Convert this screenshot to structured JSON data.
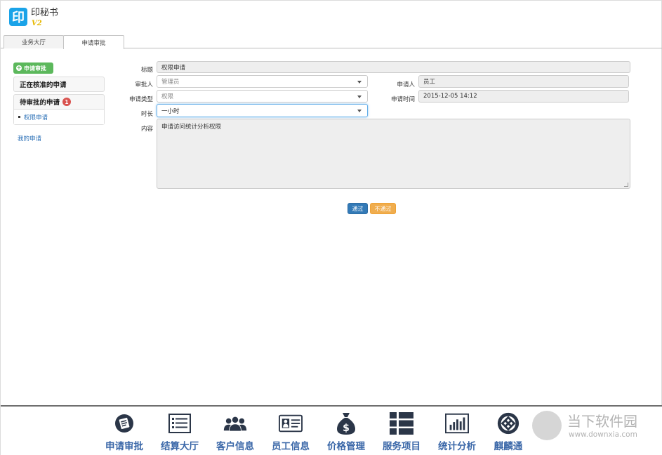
{
  "app": {
    "logo_char": "印",
    "logo_text": "印秘书",
    "version": "V2"
  },
  "tabs": [
    {
      "label": "业务大厅"
    },
    {
      "label": "申请审批"
    }
  ],
  "sidebar": {
    "apply_button": "申请审批",
    "approving_header": "正在核准的申请",
    "pending_header": "待审批的申请",
    "pending_count": "1",
    "pending_items": [
      {
        "label": "权限申请"
      }
    ],
    "my_apply": "我的申请"
  },
  "form": {
    "title_label": "标题",
    "title_value": "权限申请",
    "approver_label": "审批人",
    "approver_value": "管理员",
    "applicant_label": "申请人",
    "applicant_value": "员工",
    "type_label": "申请类型",
    "type_value": "权限",
    "time_label": "申请时间",
    "time_value": "2015-12-05 14:12",
    "duration_label": "时长",
    "duration_value": "一小时",
    "content_label": "内容",
    "content_value": "申请访问统计分析权限",
    "pass_button": "通过",
    "reject_button": "不通过"
  },
  "bottom_nav": [
    {
      "label": "申请审批",
      "icon": "approval-icon"
    },
    {
      "label": "结算大厅",
      "icon": "list-icon"
    },
    {
      "label": "客户信息",
      "icon": "users-icon"
    },
    {
      "label": "员工信息",
      "icon": "id-card-icon"
    },
    {
      "label": "价格管理",
      "icon": "money-bag-icon"
    },
    {
      "label": "服务项目",
      "icon": "grid-list-icon"
    },
    {
      "label": "统计分析",
      "icon": "bar-chart-icon"
    },
    {
      "label": "麒麟通",
      "icon": "kylin-icon"
    }
  ],
  "watermark": {
    "title": "当下软件园",
    "url": "www.downxia.com"
  },
  "colors": {
    "accent_blue": "#337ab7",
    "success_green": "#5cb85c",
    "warning_orange": "#f0ad4e",
    "danger_red": "#d9534f",
    "nav_label": "#3a67a8",
    "logo_blue": "#1aa3e8"
  }
}
